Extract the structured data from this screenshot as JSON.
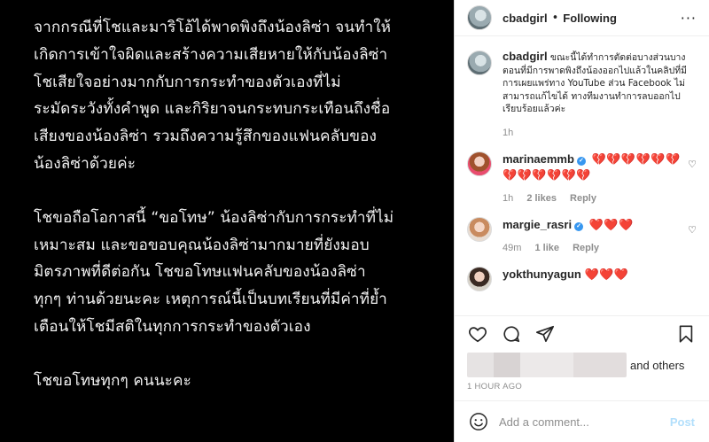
{
  "image_text": {
    "para1": [
      "จากกรณีที่โชและมาริโอ้ได้พาดพิงถึงน้องลิซ่า จนทำให้",
      "เกิดการเข้าใจผิดและสร้างความเสียหายให้กับน้องลิซ่า",
      "โชเสียใจอย่างมากกับการกระทำของตัวเองที่ไม่",
      "ระมัดระวังทั้งคำพูด และกิริยาจนกระทบกระเทือนถึงชื่อ",
      "เสียงของน้องลิซ่า รวมถึงความรู้สึกของแฟนคลับของ",
      "น้องลิซ่าด้วยค่ะ"
    ],
    "para2": [
      "โชขอถือโอกาสนี้ “ขอโทษ” น้องลิซ่ากับการกระทำที่ไม่",
      "เหมาะสม และขอขอบคุณน้องลิซ่ามากมายที่ยังมอบ",
      "มิตรภาพที่ดีต่อกัน โชขอโทษแฟนคลับของน้องลิซ่า",
      "ทุกๆ ท่านด้วยนะคะ เหตุการณ์นี้เป็นบทเรียนที่มีค่าที่ย้ำ",
      "เตือนให้โชมีสติในทุกการกระทำของตัวเอง"
    ],
    "para3": [
      "โชขอโทษทุกๆ คนนะคะ"
    ]
  },
  "header": {
    "username": "cbadgirl",
    "separator": "•",
    "follow_status": "Following",
    "more": "···"
  },
  "caption": {
    "username": "cbadgirl",
    "text": "ขณะนี้ได้ทำการตัดต่อบางส่วนบางตอนที่มีการพาดพิงถึงน้องออกไปแล้วในคลิปที่มีการเผยแพร่ทาง YouTube ส่วน Facebook ไม่สามารถแก้ไขได้ ทางทีมงานทำการลบออกไปเรียบร้อยแล้วค่ะ",
    "time": "1h"
  },
  "comments": [
    {
      "username": "marinaemmb",
      "verified": true,
      "text": "💔💔💔💔💔💔💔💔💔💔💔💔",
      "time": "1h",
      "likes": "2 likes",
      "reply": "Reply"
    },
    {
      "username": "margie_rasri",
      "verified": true,
      "text": "❤️❤️❤️",
      "time": "49m",
      "likes": "1 like",
      "reply": "Reply"
    },
    {
      "username": "yokthunyagun",
      "verified": false,
      "text": "❤️❤️❤️"
    }
  ],
  "likes": {
    "and_others": "and others"
  },
  "timestamp": "1 HOUR AGO",
  "add_comment": {
    "placeholder": "Add a comment...",
    "post_label": "Post"
  },
  "colors": {
    "accent": "#3897f0",
    "post_disabled": "#b2dffc",
    "heart": "#ed1c24"
  }
}
